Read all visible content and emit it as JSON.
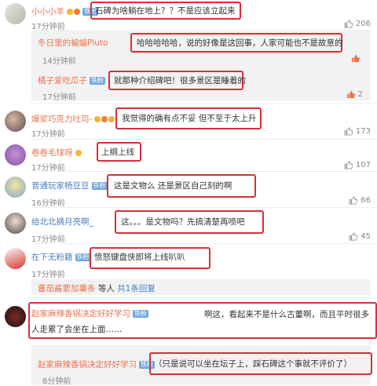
{
  "colors": {
    "highlight_border": "#d62f3a",
    "name_orange": "#eb7350",
    "name_blue": "#4a7fc1",
    "reply_bg": "#f2f2f2"
  },
  "comments": [
    {
      "user": "小小小羊",
      "badge": "铁粉",
      "text": "石碑为啥躺在地上？？不是应该立起来",
      "time": "17分钟前",
      "likes": "206",
      "liked": false
    },
    {
      "user": "冬日里的蝙蝠Pluto",
      "text": "哈哈哈哈哈，说的好像是这回事，人家可能也不是故意的",
      "time": "14分钟前",
      "likes": "",
      "liked": true
    },
    {
      "user": "橘子爱吃瓜子",
      "badge": "铁粉",
      "text": "就那种介绍碑吧！很多景区是睡着的",
      "time": "17分钟前",
      "likes": "2",
      "liked": true
    },
    {
      "user": "爆浆巧克力吐司-",
      "text": "我觉得的确有点不妥 但不至于太上升",
      "time": "17分钟前",
      "likes": "173",
      "liked": false
    },
    {
      "user": "卷卷毛球呀",
      "text": "上纲上线",
      "time": "17分钟前",
      "likes": "107",
      "liked": false
    },
    {
      "user": "普通玩家杨豆豆",
      "badge": "铁粉",
      "text": "这是文物么 还是景区自己刻的啊",
      "time": "16分钟前",
      "likes": "66",
      "liked": false
    },
    {
      "user": "给北北摘月亮啊_",
      "text": "这。。。是文物吗？先搞清楚再喷吧",
      "time": "17分钟前",
      "likes": "45",
      "liked": false
    },
    {
      "user": "在下无粉籍",
      "badge": "铁粉",
      "text": "愤怒键盘侠即将上线叭叭",
      "time": "17分钟前",
      "likes": "",
      "liked": false
    },
    {
      "user": "赵家麻辣香锅决定好好学习",
      "badge": "铁粉",
      "text": "啊这，看起来不是什么古董啊，而且平时很多人走累了会坐在上面……",
      "time": "",
      "likes": "",
      "liked": false
    },
    {
      "user": "赵家麻辣香锅决定好好学习",
      "badge": "铁粉",
      "text": "（只是说可以坐在坛子上，踩石碑这个事就不评价了）",
      "time": "8分钟前",
      "likes": "",
      "liked": false
    }
  ],
  "reply_summary": {
    "user": "蕃茄酱要加薯条",
    "suffix": "等人",
    "total": "共1条回复"
  }
}
